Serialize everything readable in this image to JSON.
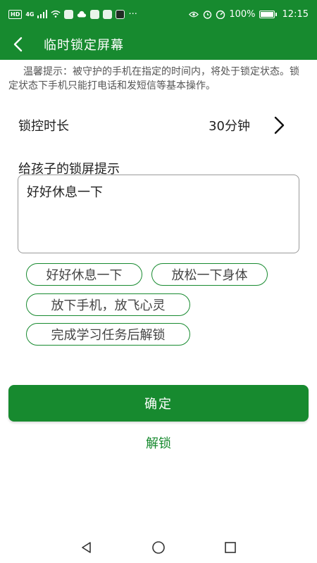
{
  "status_bar": {
    "network_tag": "HD",
    "signal_tag": "4G",
    "battery": "100%",
    "time": "12:15",
    "more": "···"
  },
  "app_bar": {
    "title": "临时锁定屏幕"
  },
  "tip": "温馨提示：被守护的手机在指定的时间内，将处于锁定状态。锁定状态下手机只能打电话和发短信等基本操作。",
  "lock_duration": {
    "label": "锁控时长",
    "value": "30分钟"
  },
  "lock_hint": {
    "label": "给孩子的锁屏提示",
    "value": "好好休息一下"
  },
  "chips": [
    "好好休息一下",
    "放松一下身体",
    "放下手机，放飞心灵",
    "完成学习任务后解锁"
  ],
  "confirm_label": "确定",
  "unlock_label": "解锁",
  "colors": {
    "brand": "#178a2f"
  }
}
